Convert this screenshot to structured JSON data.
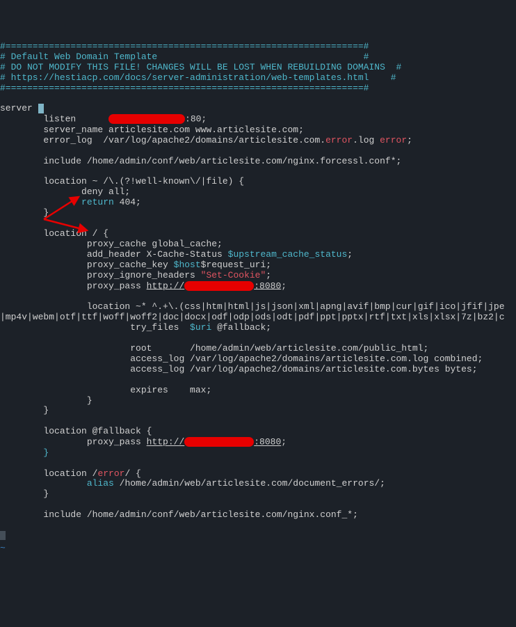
{
  "header": {
    "bar1": "#==================================================================#",
    "l1": "# Default Web Domain Template                                      #",
    "l2": "# DO NOT MODIFY THIS FILE! CHANGES WILL BE LOST WHEN REBUILDING DOMAINS  #",
    "l3": "# https://hestiacp.com/docs/server-administration/web-templates.html    #",
    "bar2": "#==================================================================#"
  },
  "server_kw": "server ",
  "listen": {
    "pre": "        listen      ",
    "port": ":80;"
  },
  "servername": {
    "pre": "        server_name articlesite.com www.articlesite.com;"
  },
  "errorlog": {
    "pre": "        error_log  /var/log/apache2/domains/articlesite.com.",
    "err": "error",
    "log": ".log ",
    "err2": "error",
    "semi": ";"
  },
  "include1": "        include /home/admin/conf/web/articlesite.com/nginx.forcessl.conf*;",
  "loc1": {
    "head": "        location ~ /\\.(?!well-known\\/|file) {",
    "deny": "               deny all;",
    "ret": "               ",
    "retk": "return",
    "retv": " 404;",
    "close": "        }"
  },
  "loc_root": {
    "head": "        location / {",
    "cache": "                proxy_cache global_cache;",
    "addh": "                add_header X-Cache-Status ",
    "addh_var": "$upstream_cache_status",
    "addh_semi": ";",
    "key": "                proxy_cache_key ",
    "key_var": "$host",
    "key_rest": "$request_uri;",
    "ign": "                proxy_ignore_headers ",
    "ign_str": "\"Set-Cookie\"",
    "ign_semi": ";",
    "pass": "                proxy_pass ",
    "pass_url": "http://",
    "pass_port": ":8080",
    "pass_semi": ";"
  },
  "loc_static": {
    "head": "                location ~* ^.+\\.(css|htm|html|js|json|xml|apng|avif|bmp|cur|gif|ico|jfif|jpe",
    "head2": "|mp4v|webm|otf|ttf|woff|woff2|doc|docx|odf|odp|ods|odt|pdf|ppt|pptx|rtf|txt|xls|xlsx|7z|bz2|c",
    "try": "                        try_files  ",
    "try_var": "$uri",
    "try_rest": " @fallback;",
    "root": "                        root       /home/admin/web/articlesite.com/public_html;",
    "acc1": "                        access_log /var/log/apache2/domains/articlesite.com.log combined;",
    "acc2": "                        access_log /var/log/apache2/domains/articlesite.com.bytes bytes;",
    "exp": "                        expires    max;",
    "close_inner": "                }",
    "close": "        }"
  },
  "fallback": {
    "head": "        location @fallback {",
    "pass": "                proxy_pass ",
    "pass_url": "http://",
    "pass_port": ":8080",
    "pass_semi": ";",
    "close": "        ",
    "close_brace": "}"
  },
  "loc_error": {
    "head_pre": "        location /",
    "head_err": "error",
    "head_post": "/ {",
    "alias_kw": "                ",
    "alias_col": "alias",
    "alias_val": " /home/admin/web/articlesite.com/document_errors/;",
    "close": "        }"
  },
  "include2": "        include /home/admin/conf/web/articlesite.com/nginx.conf_*;",
  "tilde": "~"
}
